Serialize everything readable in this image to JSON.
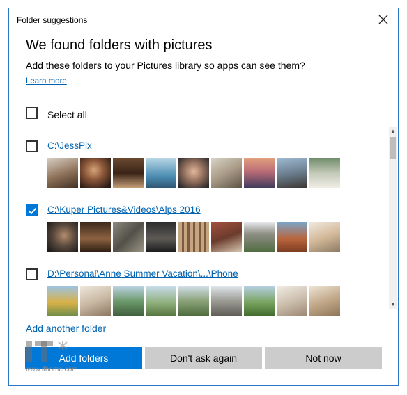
{
  "window": {
    "title": "Folder suggestions"
  },
  "main": {
    "heading": "We found folders with pictures",
    "subtitle": "Add these folders to your Pictures library so apps can see them?",
    "learn_more": "Learn more",
    "select_all": "Select all",
    "folders": [
      {
        "path": "C:\\JessPix",
        "checked": false
      },
      {
        "path": "C:\\Kuper Pictures&Videos\\Alps 2016",
        "checked": true
      },
      {
        "path": "D:\\Personal\\Anne Summer Vacation\\...\\Phone",
        "checked": false
      }
    ],
    "add_another": "Add another folder"
  },
  "buttons": {
    "add": "Add folders",
    "dont_ask": "Don't ask again",
    "not_now": "Not now"
  },
  "watermark": {
    "text": "www.ithome.com"
  },
  "colors": {
    "accent": "#0078d7",
    "link": "#0063b1",
    "button_gray": "#cccccc"
  }
}
